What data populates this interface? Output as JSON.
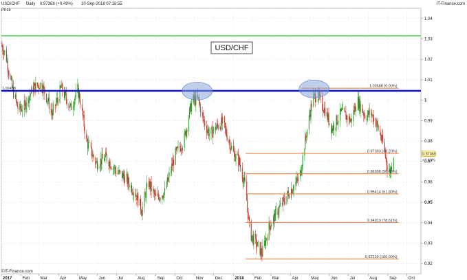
{
  "header": {
    "pair": "USD/CHF",
    "period": "Daily",
    "last": "0.97369 (+0.49%)",
    "datetime": "10-Sep-2018 07:16:55",
    "brand": "IT-Finance.com",
    "price_label": "Price"
  },
  "footer": {
    "copyright": "©IT-Finance.com"
  },
  "colors": {
    "bull": "#2ca02c",
    "bear": "#c0392b",
    "resistance": "#1616c8",
    "top_line": "#5bc85b",
    "fib": "#f08040",
    "ellipse": "#7f9fd8"
  },
  "chart_data": {
    "type": "candlestick",
    "title": "USD/CHF",
    "ylim": [
      0.915,
      1.045
    ],
    "x_range": [
      "2017-01-01",
      "2018-10-23"
    ],
    "x_tick_labels": [
      {
        "label": "2017",
        "date": "2017-01-01"
      },
      {
        "label": "Feb",
        "date": "2017-02-01"
      },
      {
        "label": "Mar",
        "date": "2017-03-01"
      },
      {
        "label": "Apr",
        "date": "2017-04-01"
      },
      {
        "label": "May",
        "date": "2017-05-01"
      },
      {
        "label": "Jun",
        "date": "2017-06-01"
      },
      {
        "label": "Jul",
        "date": "2017-07-01"
      },
      {
        "label": "Aug",
        "date": "2017-08-01"
      },
      {
        "label": "Sep",
        "date": "2017-09-01"
      },
      {
        "label": "Oct",
        "date": "2017-10-01"
      },
      {
        "label": "Nov",
        "date": "2017-11-01"
      },
      {
        "label": "Dec",
        "date": "2017-12-01"
      },
      {
        "label": "2018",
        "date": "2018-01-01"
      },
      {
        "label": "Feb",
        "date": "2018-02-01"
      },
      {
        "label": "Mar",
        "date": "2018-03-01"
      },
      {
        "label": "Apr",
        "date": "2018-04-01"
      },
      {
        "label": "May",
        "date": "2018-05-01"
      },
      {
        "label": "Jun",
        "date": "2018-06-01"
      },
      {
        "label": "Jul",
        "date": "2018-07-01"
      },
      {
        "label": "Aug",
        "date": "2018-08-01"
      },
      {
        "label": "Sep",
        "date": "2018-09-01"
      },
      {
        "label": "Oct",
        "date": "2018-10-01"
      }
    ],
    "y_ticks": [
      {
        "v": 1.04,
        "label": "1.04"
      },
      {
        "v": 1.03,
        "label": "1.03"
      },
      {
        "v": 1.02,
        "label": "1.02"
      },
      {
        "v": 1.01,
        "label": "1.01"
      },
      {
        "v": 1.0,
        "label": "1"
      },
      {
        "v": 0.99,
        "label": "0.99"
      },
      {
        "v": 0.98,
        "label": "0.98"
      },
      {
        "v": 0.97,
        "label": "0.97"
      },
      {
        "v": 0.96,
        "label": "0.96"
      },
      {
        "v": 0.95,
        "label": "0.95"
      },
      {
        "v": 0.94,
        "label": "0.94"
      },
      {
        "v": 0.93,
        "label": "0.93"
      },
      {
        "v": 0.92,
        "label": "0.92"
      }
    ],
    "grid": true,
    "price_path": [
      [
        "2017-01-01",
        1.027
      ],
      [
        "2017-01-08",
        1.022
      ],
      [
        "2017-01-18",
        1.006
      ],
      [
        "2017-01-28",
        0.995
      ],
      [
        "2017-02-06",
        0.997
      ],
      [
        "2017-02-20",
        1.006
      ],
      [
        "2017-03-05",
        1.008
      ],
      [
        "2017-03-15",
        1.0
      ],
      [
        "2017-03-22",
        0.993
      ],
      [
        "2017-04-05",
        1.006
      ],
      [
        "2017-04-20",
        0.996
      ],
      [
        "2017-05-01",
        1.005
      ],
      [
        "2017-05-05",
        1.0
      ],
      [
        "2017-05-15",
        0.98
      ],
      [
        "2017-05-30",
        0.969
      ],
      [
        "2017-06-15",
        0.972
      ],
      [
        "2017-07-01",
        0.965
      ],
      [
        "2017-07-15",
        0.962
      ],
      [
        "2017-08-01",
        0.954
      ],
      [
        "2017-08-10",
        0.946
      ],
      [
        "2017-08-20",
        0.96
      ],
      [
        "2017-09-01",
        0.952
      ],
      [
        "2017-09-15",
        0.955
      ],
      [
        "2017-10-01",
        0.973
      ],
      [
        "2017-10-15",
        0.98
      ],
      [
        "2017-10-28",
        1.0
      ],
      [
        "2017-11-07",
        1.0
      ],
      [
        "2017-11-15",
        0.99
      ],
      [
        "2017-11-25",
        0.983
      ],
      [
        "2017-12-05",
        0.987
      ],
      [
        "2017-12-15",
        0.989
      ],
      [
        "2018-01-01",
        0.974
      ],
      [
        "2018-01-10",
        0.97
      ],
      [
        "2018-01-20",
        0.957
      ],
      [
        "2018-01-27",
        0.935
      ],
      [
        "2018-02-05",
        0.93
      ],
      [
        "2018-02-15",
        0.925
      ],
      [
        "2018-02-26",
        0.938
      ],
      [
        "2018-03-10",
        0.945
      ],
      [
        "2018-03-20",
        0.95
      ],
      [
        "2018-04-01",
        0.956
      ],
      [
        "2018-04-15",
        0.962
      ],
      [
        "2018-04-25",
        0.982
      ],
      [
        "2018-05-05",
        1.0
      ],
      [
        "2018-05-12",
        1.003
      ],
      [
        "2018-05-25",
        0.995
      ],
      [
        "2018-06-05",
        0.986
      ],
      [
        "2018-06-20",
        0.994
      ],
      [
        "2018-07-05",
        0.99
      ],
      [
        "2018-07-15",
        1.0
      ],
      [
        "2018-07-28",
        0.992
      ],
      [
        "2018-08-05",
        0.994
      ],
      [
        "2018-08-15",
        0.988
      ],
      [
        "2018-08-25",
        0.978
      ],
      [
        "2018-09-01",
        0.966
      ],
      [
        "2018-09-05",
        0.965
      ],
      [
        "2018-09-10",
        0.9737
      ]
    ],
    "resistance": {
      "value": 1.00458,
      "label": "1.00458"
    },
    "top_line": {
      "value": 1.0315
    },
    "ellipses": [
      {
        "center_date": "2017-11-05",
        "center_value": 1.0045
      },
      {
        "center_date": "2018-05-08",
        "center_value": 1.0055
      }
    ],
    "fib_start_date": "2018-01-20",
    "fib_end_date": "2018-09-18",
    "fib_levels": [
      {
        "value": 1.00588,
        "label": "1.00588 (0.00%)",
        "start_date": "2018-04-18"
      },
      {
        "value": 0.97393,
        "label": "0.97393 (38.20%)"
      },
      {
        "value": 0.96398,
        "label": "0.96398 (50.00%)"
      },
      {
        "value": 0.95414,
        "label": "0.95414 (61.80%)"
      },
      {
        "value": 0.94013,
        "label": "0.94013 (78.61%)"
      },
      {
        "value": 0.92229,
        "label": "0.92229 (100.00%)"
      }
    ],
    "last_price": {
      "value": 0.97369,
      "label": "0.97369",
      "change": "+0.49%"
    }
  }
}
